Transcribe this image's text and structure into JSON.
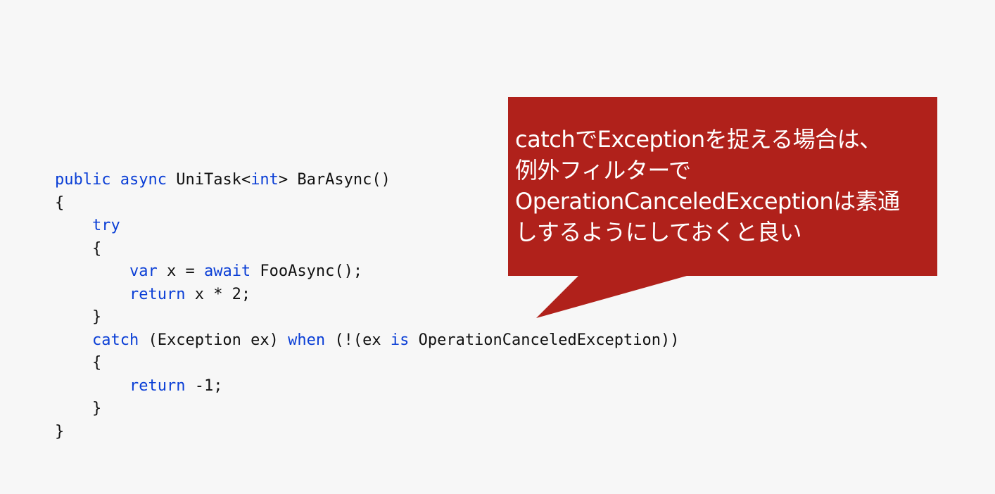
{
  "colors": {
    "background": "#f7f7f7",
    "code_text": "#111111",
    "code_keyword": "#0b3fd6",
    "callout_fill": "#b0211b",
    "callout_text": "#ffffff"
  },
  "code": {
    "lines": [
      [
        {
          "t": "public",
          "kw": true
        },
        {
          "t": " ",
          "kw": false
        },
        {
          "t": "async",
          "kw": true
        },
        {
          "t": " UniTask<",
          "kw": false
        },
        {
          "t": "int",
          "kw": true
        },
        {
          "t": "> BarAsync()",
          "kw": false
        }
      ],
      [
        {
          "t": "{",
          "kw": false
        }
      ],
      [
        {
          "t": "    ",
          "kw": false
        },
        {
          "t": "try",
          "kw": true
        }
      ],
      [
        {
          "t": "    {",
          "kw": false
        }
      ],
      [
        {
          "t": "        ",
          "kw": false
        },
        {
          "t": "var",
          "kw": true
        },
        {
          "t": " x = ",
          "kw": false
        },
        {
          "t": "await",
          "kw": true
        },
        {
          "t": " FooAsync();",
          "kw": false
        }
      ],
      [
        {
          "t": "        ",
          "kw": false
        },
        {
          "t": "return",
          "kw": true
        },
        {
          "t": " x * 2;",
          "kw": false
        }
      ],
      [
        {
          "t": "    }",
          "kw": false
        }
      ],
      [
        {
          "t": "    ",
          "kw": false
        },
        {
          "t": "catch",
          "kw": true
        },
        {
          "t": " (Exception ex) ",
          "kw": false
        },
        {
          "t": "when",
          "kw": true
        },
        {
          "t": " (!(ex ",
          "kw": false
        },
        {
          "t": "is",
          "kw": true
        },
        {
          "t": " OperationCanceledException))",
          "kw": false
        }
      ],
      [
        {
          "t": "    {",
          "kw": false
        }
      ],
      [
        {
          "t": "        ",
          "kw": false
        },
        {
          "t": "return",
          "kw": true
        },
        {
          "t": " -1;",
          "kw": false
        }
      ],
      [
        {
          "t": "    }",
          "kw": false
        }
      ],
      [
        {
          "t": "}",
          "kw": false
        }
      ]
    ]
  },
  "callout": {
    "lines": [
      "catchでExceptionを捉える場合は、",
      "例外フィルターで",
      "OperationCanceledExceptionは素通",
      "しするようにしておくと良い"
    ]
  }
}
